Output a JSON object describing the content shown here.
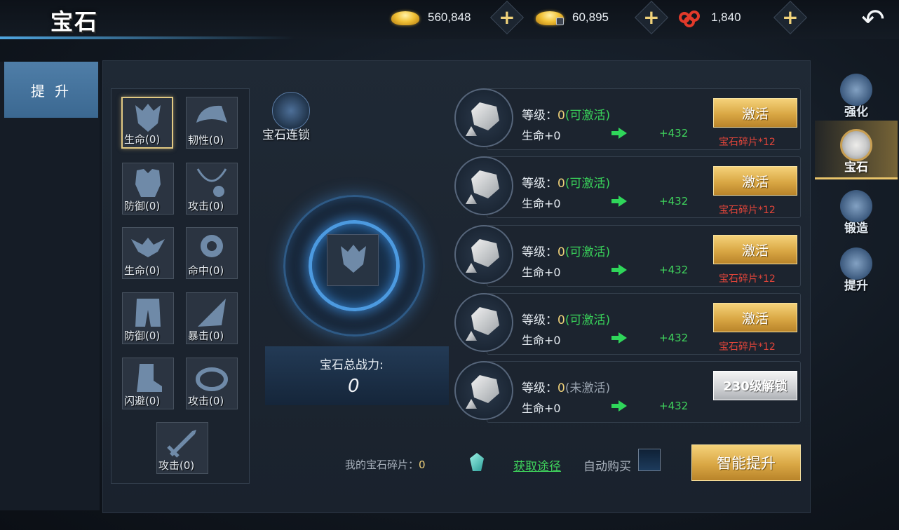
{
  "header": {
    "title": "宝石",
    "currencies": [
      {
        "icon": "gold-ingot-icon",
        "value": "560,848"
      },
      {
        "icon": "bound-gold-ingot-icon",
        "value": "60,895"
      },
      {
        "icon": "red-knot-icon",
        "value": "1,840"
      }
    ],
    "plus_label": "+",
    "back_glyph": "↶"
  },
  "left_tabs": [
    {
      "label": "提 升"
    }
  ],
  "slots": [
    {
      "label": "生命(0)",
      "icon": "helmet-icon",
      "selected": true
    },
    {
      "label": "韧性(0)",
      "icon": "shoulder-icon"
    },
    {
      "label": "防御(0)",
      "icon": "armor-icon"
    },
    {
      "label": "攻击(0)",
      "icon": "necklace-icon"
    },
    {
      "label": "生命(0)",
      "icon": "belt-icon"
    },
    {
      "label": "命中(0)",
      "icon": "bracer-icon"
    },
    {
      "label": "防御(0)",
      "icon": "leggings-icon"
    },
    {
      "label": "暴击(0)",
      "icon": "blade-icon"
    },
    {
      "label": "闪避(0)",
      "icon": "boots-icon"
    },
    {
      "label": "攻击(0)",
      "icon": "ring-icon"
    },
    {
      "label": "攻击(0)",
      "icon": "sword-icon"
    }
  ],
  "center": {
    "chain_label": "宝石连锁",
    "power_label": "宝石总战力:",
    "power_value": "0"
  },
  "gem_rows": [
    {
      "level_prefix": "等级：",
      "level": "0",
      "status": "(可激活)",
      "hp": "生命+0",
      "bonus": "+432",
      "button": "激活",
      "cost": "宝石碎片*12",
      "locked": false
    },
    {
      "level_prefix": "等级：",
      "level": "0",
      "status": "(可激活)",
      "hp": "生命+0",
      "bonus": "+432",
      "button": "激活",
      "cost": "宝石碎片*12",
      "locked": false
    },
    {
      "level_prefix": "等级：",
      "level": "0",
      "status": "(可激活)",
      "hp": "生命+0",
      "bonus": "+432",
      "button": "激活",
      "cost": "宝石碎片*12",
      "locked": false
    },
    {
      "level_prefix": "等级：",
      "level": "0",
      "status": "(可激活)",
      "hp": "生命+0",
      "bonus": "+432",
      "button": "激活",
      "cost": "宝石碎片*12",
      "locked": false
    },
    {
      "level_prefix": "等级：",
      "level": "0",
      "status": "(未激活)",
      "hp": "生命+0",
      "bonus": "+432",
      "button": "230级解锁",
      "cost": "",
      "locked": true
    }
  ],
  "bottom": {
    "fragments_label": "我的宝石碎片：",
    "fragments_value": "0",
    "get_link": "获取途径",
    "auto_buy_label": "自动购买",
    "auto_buy_checked": false,
    "smart_button": "智能提升"
  },
  "right_nav": [
    {
      "label": "强化",
      "icon": "enhance-icon",
      "active": false
    },
    {
      "label": "宝石",
      "icon": "gem-icon",
      "active": true
    },
    {
      "label": "锻造",
      "icon": "forge-icon",
      "active": false
    },
    {
      "label": "提升",
      "icon": "upgrade-icon",
      "active": false
    }
  ],
  "colors": {
    "accent_gold": "#d9a744",
    "active_green": "#39d35a",
    "cost_red": "#e2453a"
  }
}
